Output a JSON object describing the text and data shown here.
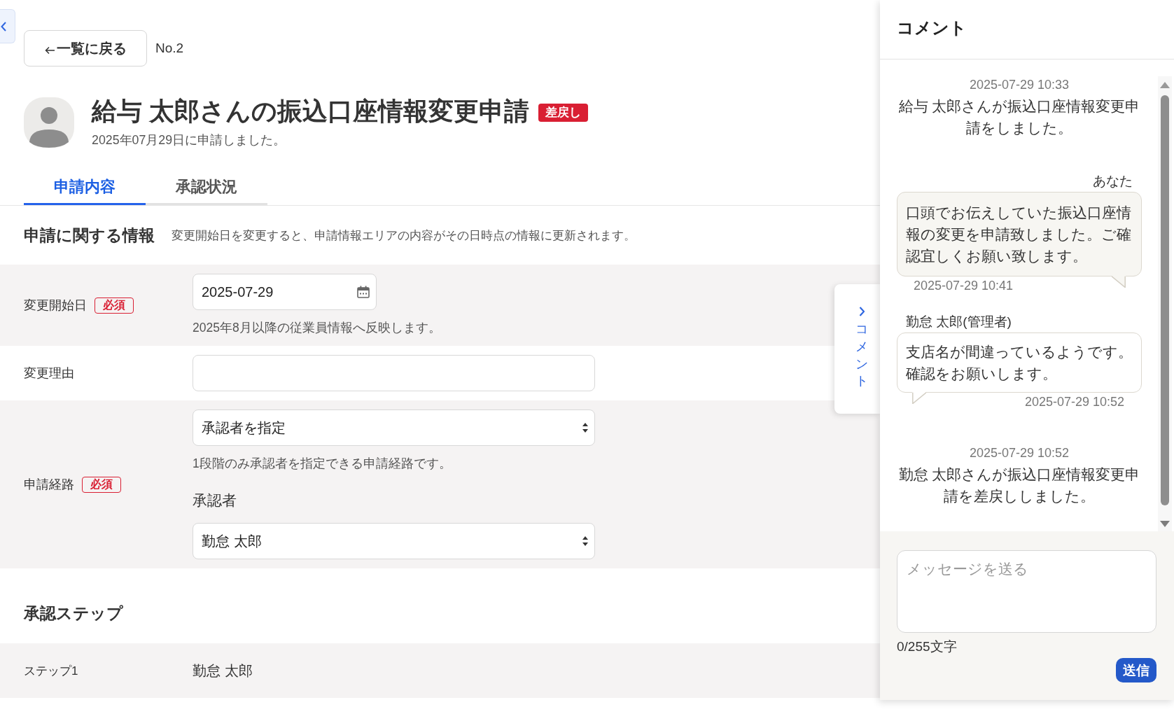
{
  "header": {
    "back_button": "一覧に戻る",
    "number": "No.2"
  },
  "request": {
    "title": "給与 太郎さんの振込口座情報変更申請",
    "status": {
      "kind": "returned",
      "label": "差戻し"
    },
    "submitted_note": "2025年07月29日に申請しました。"
  },
  "tabs": [
    {
      "label": "申請内容",
      "selected": true
    },
    {
      "label": "承認状況",
      "selected": false
    }
  ],
  "info_section": {
    "heading": "申請に関する情報",
    "description": "変更開始日を変更すると、申請情報エリアの内容がその日時点の情報に更新されます。"
  },
  "form_rows": [
    {
      "label": "変更開始日",
      "required": true,
      "required_badge": "必須",
      "fields": [
        {
          "kind": "date",
          "value": "2025-07-29"
        },
        {
          "kind": "hint",
          "text": "2025年8月以降の従業員情報へ反映します。"
        }
      ]
    },
    {
      "label": "変更理由",
      "required": false,
      "fields": [
        {
          "kind": "text"
        }
      ]
    },
    {
      "label": "申請経路",
      "required": true,
      "required_badge": "必須",
      "fields": [
        {
          "kind": "select",
          "value": "承認者を指定"
        },
        {
          "kind": "hint",
          "text": "1段階のみ承認者を指定できる申請経路です。"
        },
        {
          "kind": "label",
          "text": "承認者"
        },
        {
          "kind": "select",
          "value": "勤怠 太郎"
        }
      ]
    }
  ],
  "approval_steps": {
    "heading": "承認ステップ",
    "rows": [
      {
        "step": "ステップ1",
        "approver": "勤怠 太郎"
      }
    ]
  },
  "comment_tab": {
    "label": "コメント"
  },
  "comments": {
    "title": "コメント",
    "messages": [
      {
        "kind": "system",
        "time": "2025-07-29 10:33",
        "text": "給与 太郎さんが振込口座情報変更申請をしました。"
      },
      {
        "kind": "own",
        "author": "あなた",
        "text": "口頭でお伝えしていた振込口座情報の変更を申請致しました。ご確認宜しくお願い致します。",
        "time": "2025-07-29 10:41"
      },
      {
        "kind": "other",
        "author": "勤怠 太郎(管理者)",
        "text": "支店名が間違っているようです。確認をお願いします。",
        "time": "2025-07-29 10:52"
      },
      {
        "kind": "system",
        "time": "2025-07-29 10:52",
        "text": "勤怠 太郎さんが振込口座情報変更申請を差戻ししました。"
      }
    ],
    "composer": {
      "placeholder": "メッセージを送る",
      "counter": "0/255文字",
      "send_button": "送信"
    }
  }
}
